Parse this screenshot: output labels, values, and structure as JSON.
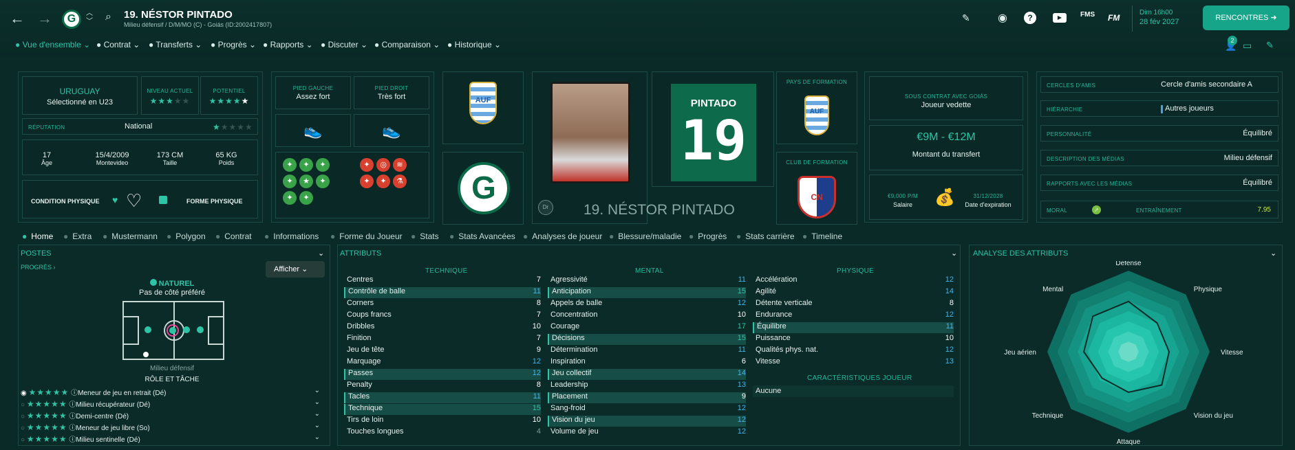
{
  "header": {
    "name": "19. NÉSTOR PINTADO",
    "subtitle": "Milieu défensif / D/M/MO (C) - Goiás (ID:2002417807)",
    "date_line1": "Dim 16h00",
    "date_line2": "28 fév 2027",
    "button": "RENCONTRES",
    "notif": "2"
  },
  "nav": [
    "Vue d'ensemble",
    "Contrat",
    "Transferts",
    "Progrès",
    "Rapports",
    "Discuter",
    "Comparaison",
    "Historique"
  ],
  "profile": {
    "nation": "URUGUAY",
    "nation_sub": "Sélectionné en U23",
    "niveau_label": "NIVEAU ACTUEL",
    "potentiel_label": "POTENTIEL",
    "reputation_label": "RÉPUTATION",
    "reputation": "National",
    "age": "17",
    "age_label": "Âge",
    "dob": "15/4/2009",
    "birthplace": "Montevideo",
    "height": "173 CM",
    "height_label": "Taille",
    "weight": "65 KG",
    "weight_label": "Poids",
    "condition_label": "CONDITION PHYSIQUE",
    "forme_label": "FORME PHYSIQUE",
    "current_stars": 3,
    "potential_stars": 4.5,
    "reputation_stars": 1
  },
  "feet": {
    "left_label": "PIED GAUCHE",
    "left": "Assez fort",
    "right_label": "PIED DROIT",
    "right": "Très fort"
  },
  "shirt": {
    "name": "PINTADO",
    "number": "19"
  },
  "name_bar": "19. NÉSTOR PINTADO",
  "formation": {
    "country_label": "PAYS DE FORMATION",
    "club_label": "CLUB DE FORMATION"
  },
  "contract": {
    "label": "SOUS CONTRAT AVEC GOIÁS",
    "status": "Joueur vedette",
    "value": "€9M - €12M",
    "value_label": "Montant du transfert",
    "salary": "€9,000 P/M",
    "salary_label": "Salaire",
    "expiry": "31/12/2028",
    "expiry_label": "Date d'expiration"
  },
  "info": [
    {
      "label": "CERCLES D'AMIS",
      "value": "Cercle d'amis secondaire A"
    },
    {
      "label": "HIÉRARCHIE",
      "value": "Autres joueurs"
    },
    {
      "label": "PERSONNALITÉ",
      "value": "Équilibré"
    },
    {
      "label": "DESCRIPTION DES MÉDIAS",
      "value": "Milieu défensif"
    },
    {
      "label": "RAPPORTS AVEC LES MÉDIAS",
      "value": "Équilibré"
    }
  ],
  "morale": {
    "label": "MORAL",
    "training_label": "ENTRAÎNEMENT",
    "training": "7.95"
  },
  "tabs": [
    "Home",
    "Extra",
    "Mustermann",
    "Polygon",
    "Contrat",
    "Informations",
    "Forme du Joueur",
    "Stats",
    "Stats Avancées",
    "Analyses de joueur",
    "Blessure/maladie",
    "Progrès",
    "Stats carrière",
    "Timeline"
  ],
  "postes": {
    "title": "POSTES",
    "progress_link": "PROGRÈS",
    "show_button": "Afficher",
    "naturel": "NATUREL",
    "side": "Pas de côté préféré",
    "position": "Milieu défensif",
    "role_title": "RÔLE ET TÂCHE",
    "roles": [
      "Meneur de jeu en retrait (Dé)",
      "Milieu récupérateur (Dé)",
      "Demi-centre (Dé)",
      "Meneur de jeu libre (So)",
      "Milieu sentinelle (Dé)"
    ]
  },
  "attributes": {
    "title": "ATTRIBUTS",
    "technique_label": "TECHNIQUE",
    "mental_label": "MENTAL",
    "physique_label": "PHYSIQUE",
    "traits_label": "CARACTÉRISTIQUES JOUEUR",
    "traits": "Aucune",
    "technique": [
      [
        "Centres",
        "7"
      ],
      [
        "Contrôle de balle",
        "11"
      ],
      [
        "Corners",
        "8"
      ],
      [
        "Coups francs",
        "7"
      ],
      [
        "Dribbles",
        "10"
      ],
      [
        "Finition",
        "7"
      ],
      [
        "Jeu de tête",
        "9"
      ],
      [
        "Marquage",
        "12"
      ],
      [
        "Passes",
        "12"
      ],
      [
        "Penalty",
        "8"
      ],
      [
        "Tacles",
        "11"
      ],
      [
        "Technique",
        "15"
      ],
      [
        "Tirs de loin",
        "10"
      ],
      [
        "Touches longues",
        "4"
      ]
    ],
    "mental": [
      [
        "Agressivité",
        "11"
      ],
      [
        "Anticipation",
        "15"
      ],
      [
        "Appels de balle",
        "12"
      ],
      [
        "Concentration",
        "10"
      ],
      [
        "Courage",
        "17"
      ],
      [
        "Décisions",
        "15"
      ],
      [
        "Détermination",
        "11"
      ],
      [
        "Inspiration",
        "6"
      ],
      [
        "Jeu collectif",
        "14"
      ],
      [
        "Leadership",
        "13"
      ],
      [
        "Placement",
        "9"
      ],
      [
        "Sang-froid",
        "12"
      ],
      [
        "Vision du jeu",
        "12"
      ],
      [
        "Volume de jeu",
        "12"
      ]
    ],
    "physique": [
      [
        "Accélération",
        "12"
      ],
      [
        "Agilité",
        "14"
      ],
      [
        "Détente verticale",
        "8"
      ],
      [
        "Endurance",
        "12"
      ],
      [
        "Équilibre",
        "11"
      ],
      [
        "Puissance",
        "10"
      ],
      [
        "Qualités phys. nat.",
        "12"
      ],
      [
        "Vitesse",
        "13"
      ]
    ]
  },
  "radar": {
    "title": "ANALYSE DES ATTRIBUTS",
    "labels": [
      "Défense",
      "Physique",
      "Vitesse",
      "Vision du jeu",
      "Attaque",
      "Technique",
      "Jeu aérien",
      "Mental"
    ],
    "values": [
      0.62,
      0.5,
      0.5,
      0.58,
      0.5,
      0.46,
      0.55,
      0.62
    ]
  },
  "colors": {
    "accent": "#2ec4a6",
    "panel": "#0b2b28",
    "radar": "#14a58c"
  }
}
